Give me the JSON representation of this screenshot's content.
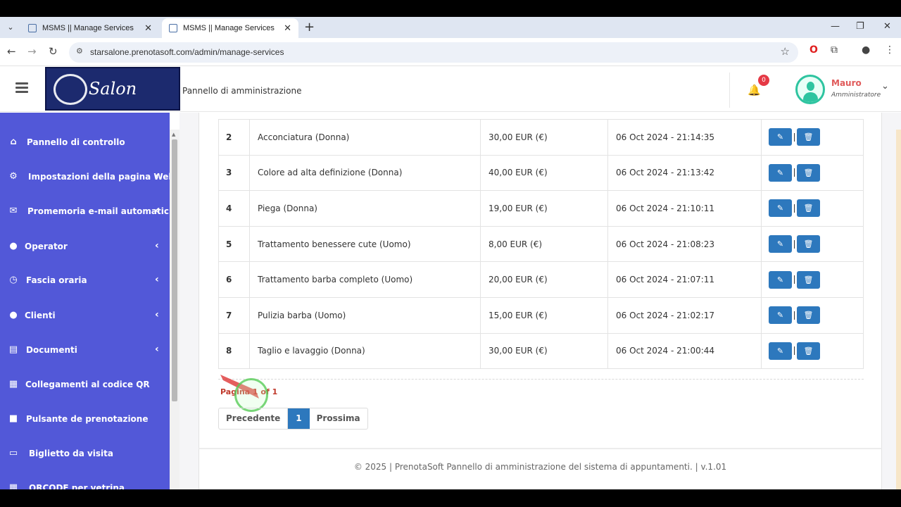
{
  "browser": {
    "tabs": [
      {
        "title": "MSMS || Manage Services",
        "active": false
      },
      {
        "title": "MSMS || Manage Services",
        "active": true
      }
    ],
    "url": "starsalone.prenotasoft.com/admin/manage-services"
  },
  "header": {
    "logo_text": "Salon",
    "title": "Pannello di amministrazione",
    "notification_count": "0",
    "user": {
      "name": "Mauro",
      "role": "Amministratore"
    }
  },
  "sidebar": {
    "items": [
      {
        "label": "Pannello di controllo",
        "icon": "home-icon",
        "has_submenu": false
      },
      {
        "label": "Impostazioni della pagina Web",
        "icon": "cogs-icon",
        "has_submenu": true
      },
      {
        "label": "Promemoria e-mail automatici",
        "icon": "envelope-icon",
        "has_submenu": true
      },
      {
        "label": "Operator",
        "icon": "user-icon",
        "has_submenu": true
      },
      {
        "label": "Fascia oraria",
        "icon": "clock-icon",
        "has_submenu": true
      },
      {
        "label": "Clienti",
        "icon": "user-icon",
        "has_submenu": true
      },
      {
        "label": "Documenti",
        "icon": "document-icon",
        "has_submenu": true
      },
      {
        "label": "Collegamenti al codice QR",
        "icon": "qrcode-icon",
        "has_submenu": false
      },
      {
        "label": "Pulsante de prenotazione",
        "icon": "square-icon",
        "has_submenu": false
      },
      {
        "label": "Biglietto da visita",
        "icon": "id-card-icon",
        "has_submenu": false
      },
      {
        "label": "QRCODE per vetrina",
        "icon": "qrcode-icon",
        "has_submenu": false
      }
    ]
  },
  "services": {
    "rows": [
      {
        "num": "2",
        "name": "Acconciatura (Donna)",
        "price": "30,00 EUR (€)",
        "date": "06 Oct 2024 - 21:14:35"
      },
      {
        "num": "3",
        "name": "Colore ad alta definizione (Donna)",
        "price": "40,00 EUR (€)",
        "date": "06 Oct 2024 - 21:13:42"
      },
      {
        "num": "4",
        "name": "Piega (Donna)",
        "price": "19,00 EUR (€)",
        "date": "06 Oct 2024 - 21:10:11"
      },
      {
        "num": "5",
        "name": "Trattamento benessere cute (Uomo)",
        "price": "8,00 EUR (€)",
        "date": "06 Oct 2024 - 21:08:23"
      },
      {
        "num": "6",
        "name": "Trattamento barba completo (Uomo)",
        "price": "20,00 EUR (€)",
        "date": "06 Oct 2024 - 21:07:11"
      },
      {
        "num": "7",
        "name": "Pulizia barba (Uomo)",
        "price": "15,00 EUR (€)",
        "date": "06 Oct 2024 - 21:02:17"
      },
      {
        "num": "8",
        "name": "Taglio e lavaggio (Donna)",
        "price": "30,00 EUR (€)",
        "date": "06 Oct 2024 - 21:00:44"
      }
    ]
  },
  "pagination": {
    "info": "Pagina 1 of 1",
    "prev_label": "Precedente",
    "current": "1",
    "next_label": "Prossima"
  },
  "footer": {
    "text": "© 2025 | PrenotaSoft Pannello di amministrazione del sistema di appuntamenti. | v.1.01"
  },
  "colors": {
    "sidebar_bg": "#5258d8",
    "action_button": "#2d78bd",
    "accent_red": "#c0392b",
    "avatar_ring": "#2ec4a0"
  }
}
